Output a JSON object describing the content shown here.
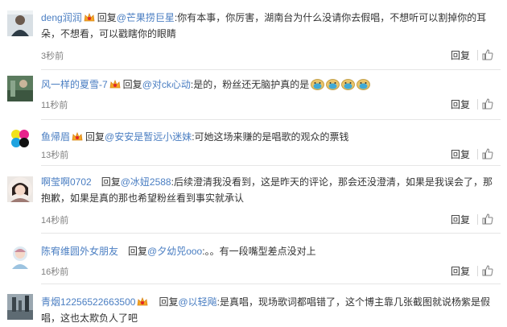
{
  "comments": [
    {
      "username": "deng润润",
      "reply_label": "回复",
      "reply_to": "@芒果捞巨星",
      "content": ":你有本事，你厉害，湖南台为什么没请你去假唱，不想听可以割掉你的耳朵，不想看，可以戳瞎你的眼睛",
      "time": "3秒前",
      "action_reply": "回复"
    },
    {
      "username": "风一样的夏雪-7",
      "reply_label": "回复",
      "reply_to": "@对ck心动",
      "content": ":是的，粉丝还无脑护真的是",
      "emoji_count": 4,
      "time": "11秒前",
      "action_reply": "回复"
    },
    {
      "username": "鱼帰眉",
      "reply_label": "回复",
      "reply_to": "@安安是暂远小迷妹",
      "content": ":可她这场来赚的是唱歌的观众的票钱",
      "time": "13秒前",
      "action_reply": "回复"
    },
    {
      "username": "啊莹啊0702",
      "reply_label": "回复",
      "reply_to": "@冰妞2588",
      "content": ":后续澄清我没看到，这是昨天的评论，那会还没澄清，如果是我误会了，那抱歉，如果是真的那也希望粉丝看到事实就承认",
      "time": "14秒前",
      "action_reply": "回复"
    },
    {
      "username": "陈宥维圆外女朋友",
      "reply_label": "回复",
      "reply_to": "@夕幼兕ooo",
      "content": ":。。有一段嘴型差点没对上",
      "time": "16秒前",
      "action_reply": "回复"
    },
    {
      "username": "青烟12256522663500",
      "reply_label": "回复",
      "reply_to": "@以轻飚",
      "content": ":是真唱，现场歌词都唱错了，这个博主靠几张截图就说杨紫是假唱，这也太欺负人了吧",
      "time": "",
      "action_reply": ""
    }
  ],
  "colors": {
    "link": "#4a7ec2",
    "time": "#808080",
    "text": "#333333",
    "divider": "#e6e6e6"
  },
  "icons": {
    "badge": "vip-crown-badge",
    "emoji": "doge-emoji",
    "like": "thumbs-up-icon"
  }
}
